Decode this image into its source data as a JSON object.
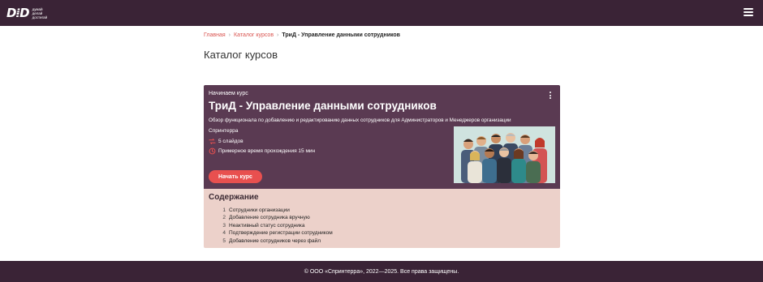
{
  "header": {
    "logo_mark": "D⁞D",
    "logo_lines": [
      "думай",
      "делай",
      "достигай"
    ],
    "menu_icon": "hamburger-icon"
  },
  "breadcrumb": {
    "items": [
      "Главная",
      "Каталог курсов"
    ],
    "current": "ТриД - Управление данными сотрудников",
    "separator": "›"
  },
  "page": {
    "title": "Каталог курсов"
  },
  "course": {
    "eyebrow": "Начинаем курс",
    "title": "ТриД - Управление данными сотрудников",
    "description": "Обзор функционала по добавлению и редактированию данных сотрудников для Администраторов и Менеджеров организации",
    "author": "Спринтерра",
    "slides": "5 слайдов",
    "duration": "Примерное время прохождения 15 мин",
    "start_label": "Начать курс",
    "image_alt": "team-illustration",
    "colors": {
      "hero": "#5a3a52",
      "accent": "#e8504f",
      "contents_bg": "#ecd1ca"
    }
  },
  "contents": {
    "title": "Содержание",
    "items": [
      {
        "num": "1",
        "label": "Сотрудники организации"
      },
      {
        "num": "2",
        "label": "Добавление сотрудника вручную"
      },
      {
        "num": "3",
        "label": "Неактивный статус сотрудника"
      },
      {
        "num": "4",
        "label": "Подтверждение регистрации сотрудником"
      },
      {
        "num": "5",
        "label": "Добавление сотрудников через файл"
      }
    ]
  },
  "footer": {
    "text": "© ООО «Спринтерра», 2022—2025. Все права защищены."
  }
}
